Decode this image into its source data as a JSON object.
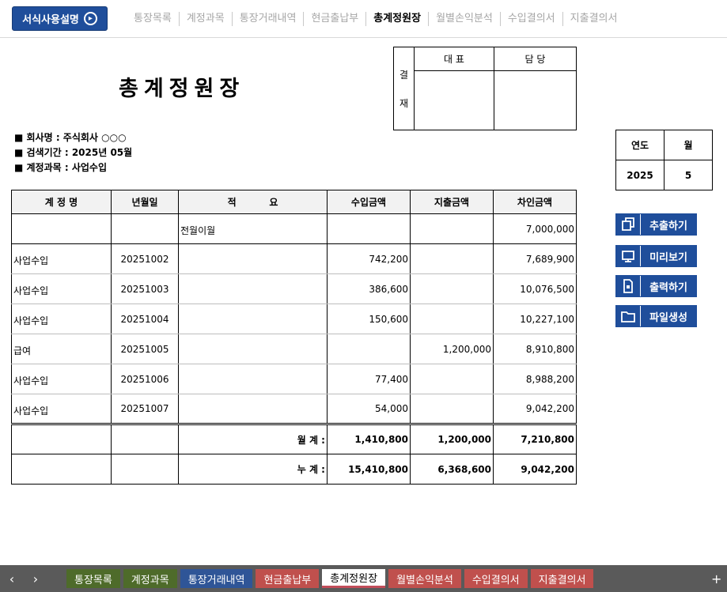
{
  "topnav": {
    "guide_button": "서식사용설명",
    "links": [
      "통장목록",
      "계정과목",
      "통장거래내역",
      "현금출납부",
      "총계정원장",
      "월별손익분석",
      "수입결의서",
      "지출결의서"
    ],
    "active": "총계정원장"
  },
  "title": "총계정원장",
  "approval": {
    "side_top": "결",
    "side_bottom": "재",
    "col1": "대 표",
    "col2": "담 당"
  },
  "info": {
    "company": "■ 회사명 : 주식회사 ○○○",
    "period": "■ 검색기간 : 2025년 05월",
    "account": "■ 계정과목 : 사업수입"
  },
  "year_month": {
    "year_label": "연도",
    "month_label": "월",
    "year": "2025",
    "month": "5"
  },
  "actions": [
    {
      "label": "추출하기",
      "icon": "copy-icon"
    },
    {
      "label": "미리보기",
      "icon": "monitor-icon"
    },
    {
      "label": "출력하기",
      "icon": "print-icon"
    },
    {
      "label": "파일생성",
      "icon": "folder-icon"
    }
  ],
  "ledger": {
    "headers": [
      "계 정 명",
      "년월일",
      "적          요",
      "수입금액",
      "지출금액",
      "차인금액"
    ],
    "rows": [
      {
        "account": "",
        "date": "",
        "desc": "전월이월",
        "income": "",
        "expense": "",
        "balance": "7,000,000"
      },
      {
        "account": "사업수입",
        "date": "20251002",
        "desc": "",
        "income": "742,200",
        "expense": "",
        "balance": "7,689,900"
      },
      {
        "account": "사업수입",
        "date": "20251003",
        "desc": "",
        "income": "386,600",
        "expense": "",
        "balance": "10,076,500"
      },
      {
        "account": "사업수입",
        "date": "20251004",
        "desc": "",
        "income": "150,600",
        "expense": "",
        "balance": "10,227,100"
      },
      {
        "account": "급여",
        "date": "20251005",
        "desc": "",
        "income": "",
        "expense": "1,200,000",
        "balance": "8,910,800"
      },
      {
        "account": "사업수입",
        "date": "20251006",
        "desc": "",
        "income": "77,400",
        "expense": "",
        "balance": "8,988,200"
      },
      {
        "account": "사업수입",
        "date": "20251007",
        "desc": "",
        "income": "54,000",
        "expense": "",
        "balance": "9,042,200"
      }
    ],
    "monthly": {
      "label": "월 계 :",
      "income": "1,410,800",
      "expense": "1,200,000",
      "balance": "7,210,800"
    },
    "cumulative": {
      "label": "누 계 :",
      "income": "15,410,800",
      "expense": "6,368,600",
      "balance": "9,042,200"
    }
  },
  "sheet_tabs": {
    "tabs": [
      {
        "label": "통장목록",
        "color": "#4e6b2a"
      },
      {
        "label": "계정과목",
        "color": "#4e6b2a"
      },
      {
        "label": "통장거래내역",
        "color": "#2f5597"
      },
      {
        "label": "현금출납부",
        "color": "#c0504d"
      },
      {
        "label": "총계정원장",
        "color": "#ffffff"
      },
      {
        "label": "월별손익분석",
        "color": "#c0504d"
      },
      {
        "label": "수입결의서",
        "color": "#c0504d"
      },
      {
        "label": "지출결의서",
        "color": "#c0504d"
      }
    ],
    "active": "총계정원장"
  }
}
